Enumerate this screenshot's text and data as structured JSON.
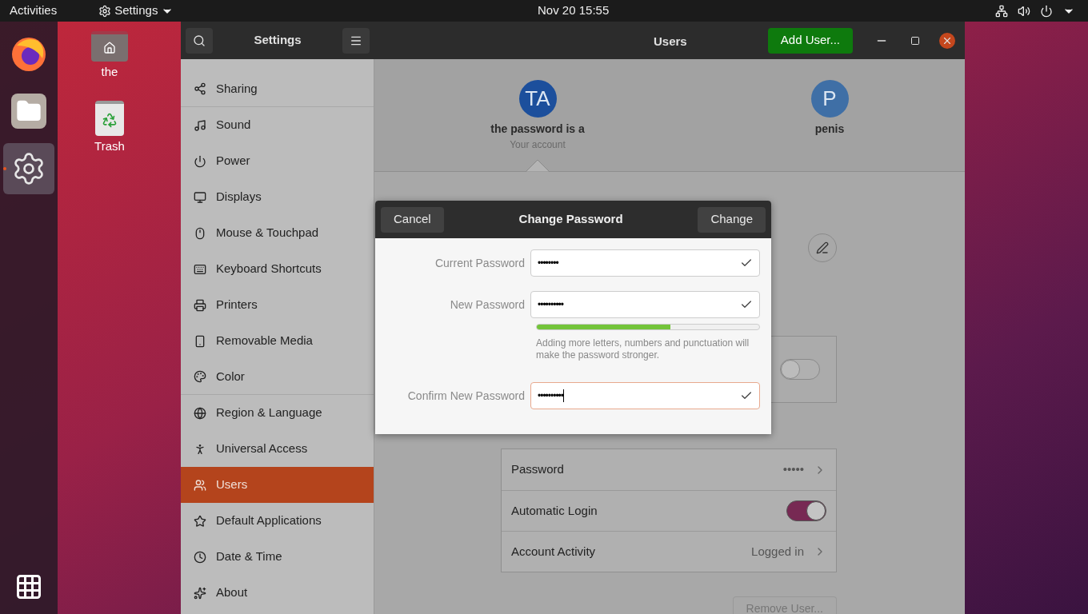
{
  "top_bar": {
    "activities": "Activities",
    "app_menu": "Settings",
    "clock": "Nov 20  15:55"
  },
  "dock": [
    {
      "kind": "browser",
      "selected": false
    },
    {
      "kind": "files",
      "selected": false
    },
    {
      "kind": "settings",
      "selected": true
    }
  ],
  "desktop_icons": [
    {
      "kind": "home",
      "label": "the"
    },
    {
      "kind": "trash",
      "label": "Trash"
    }
  ],
  "window": {
    "sidebar_title": "Settings",
    "page_title": "Users",
    "add_button": "Add User...",
    "sidebar": [
      {
        "label": "Sharing",
        "selected": false
      },
      {
        "label": "Sound",
        "selected": false
      },
      {
        "label": "Power",
        "selected": false
      },
      {
        "label": "Displays",
        "selected": false
      },
      {
        "label": "Mouse & Touchpad",
        "selected": false
      },
      {
        "label": "Keyboard Shortcuts",
        "selected": false
      },
      {
        "label": "Printers",
        "selected": false
      },
      {
        "label": "Removable Media",
        "selected": false
      },
      {
        "label": "Color",
        "selected": false
      },
      {
        "label": "Region & Language",
        "selected": false
      },
      {
        "label": "Universal Access",
        "selected": false
      },
      {
        "label": "Users",
        "selected": true
      },
      {
        "label": "Default Applications",
        "selected": false
      },
      {
        "label": "Date & Time",
        "selected": false
      },
      {
        "label": "About",
        "selected": false
      }
    ],
    "users": [
      {
        "initials": "TA",
        "name": "the password is a",
        "subtitle": "Your account",
        "color": "#1c4f9c",
        "selected": true
      },
      {
        "initials": "P",
        "name": "penis",
        "color": "#3f6fa6",
        "selected": false
      }
    ],
    "admin_switch": {
      "on": false
    },
    "auth_rows": [
      {
        "kind": "link",
        "label": "Password",
        "value": "•••••"
      },
      {
        "kind": "switch",
        "label": "Automatic Login",
        "on": true
      },
      {
        "kind": "link",
        "label": "Account Activity",
        "value": "Logged in"
      }
    ],
    "remove_button": "Remove User..."
  },
  "dialog": {
    "title": "Change Password",
    "cancel": "Cancel",
    "confirm": "Change",
    "fields": [
      {
        "label": "Current Password",
        "value": "••••••••",
        "valid": true,
        "focused": false
      },
      {
        "label": "New Password",
        "value": "••••••••••",
        "valid": true,
        "focused": false
      },
      {
        "label": "Confirm New Password",
        "value": "••••••••••",
        "valid": true,
        "focused": true
      }
    ],
    "strength": {
      "level": 0.6
    },
    "hint": "Adding more letters, numbers and punctuation will make the password stronger."
  }
}
